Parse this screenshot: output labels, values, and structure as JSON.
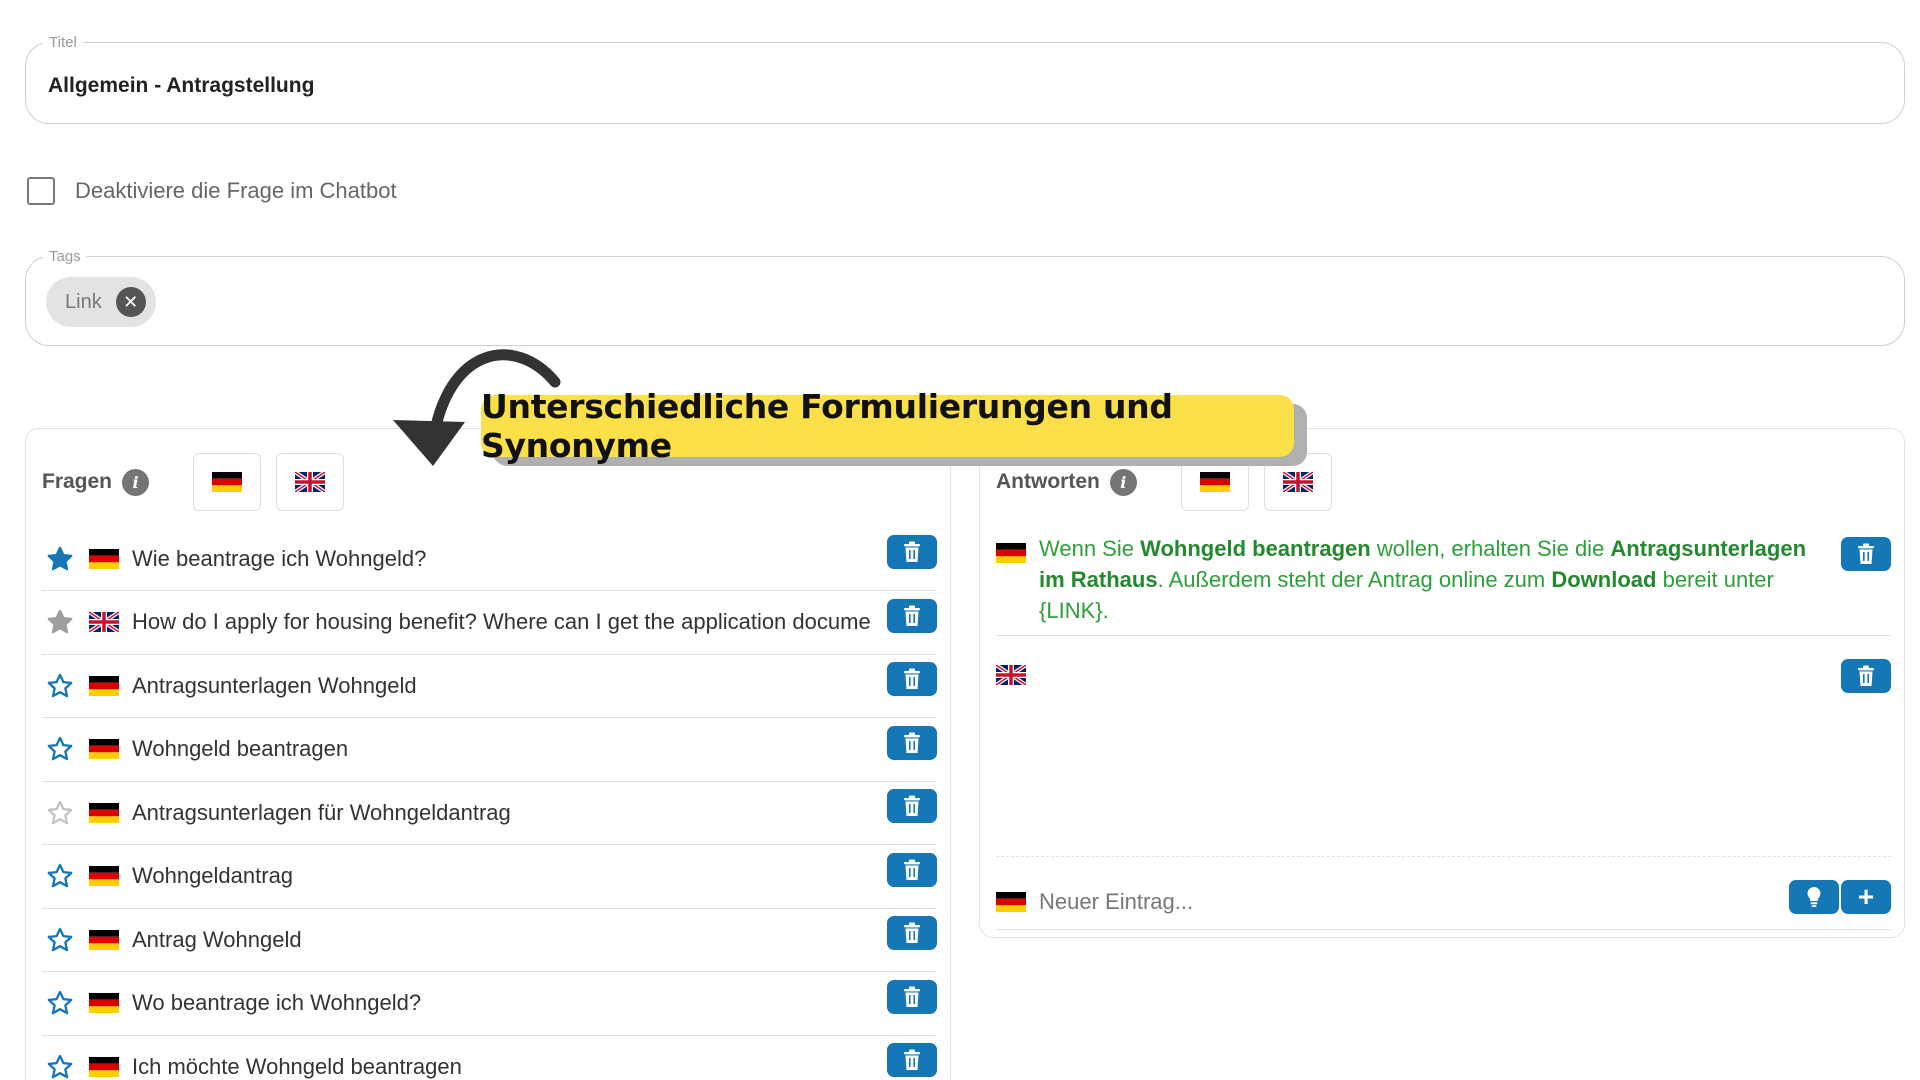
{
  "title_field": {
    "label": "Titel",
    "value": "Allgemein - Antragstellung"
  },
  "deactivate": {
    "label": "Deaktiviere die Frage im Chatbot",
    "checked": false
  },
  "tags_field": {
    "label": "Tags",
    "tags": [
      {
        "label": "Link",
        "remove_icon": "close-circle-icon"
      }
    ]
  },
  "callout": {
    "text": "Unterschiedliche Formulierungen und Synonyme",
    "background": "#fbe049"
  },
  "fragen": {
    "title": "Fragen",
    "languages": [
      "de-flag-icon",
      "gb-flag-icon"
    ],
    "items": [
      {
        "star": "filled",
        "lang": "de",
        "text": "Wie beantrage ich Wohngeld?"
      },
      {
        "star": "gray",
        "lang": "en",
        "text": "How do I apply for housing benefit? Where can I get the application documents?"
      },
      {
        "star": "outline",
        "lang": "de",
        "text": "Antragsunterlagen Wohngeld"
      },
      {
        "star": "outline",
        "lang": "de",
        "text": "Wohngeld beantragen"
      },
      {
        "star": "light",
        "lang": "de",
        "text": "Antragsunterlagen für Wohngeldantrag"
      },
      {
        "star": "outline",
        "lang": "de",
        "text": "Wohngeldantrag"
      },
      {
        "star": "outline",
        "lang": "de",
        "text": "Antrag Wohngeld"
      },
      {
        "star": "outline",
        "lang": "de",
        "text": "Wo beantrage ich Wohngeld?"
      },
      {
        "star": "outline",
        "lang": "de",
        "text": "Ich möchte Wohngeld beantragen"
      }
    ]
  },
  "antworten": {
    "title": "Antworten",
    "languages": [
      "de-flag-icon",
      "gb-flag-icon"
    ],
    "answer_de": {
      "t1": "Wenn Sie ",
      "b1": "Wohngeld beantragen",
      "t2": " wollen, erhalten Sie die ",
      "b2": "Antragsunterlagen im Rathaus",
      "t3": ". Außerdem steht der Antrag online zum ",
      "b3": "Download",
      "t4": " bereit unter {LINK}."
    },
    "answer_en": "",
    "new_entry": {
      "placeholder": "Neuer Eintrag...",
      "value": ""
    },
    "add_label": "+"
  },
  "colors": {
    "accent": "#1677b6",
    "answer_text": "#2e9e3a",
    "star_blue": "#1677b6"
  }
}
